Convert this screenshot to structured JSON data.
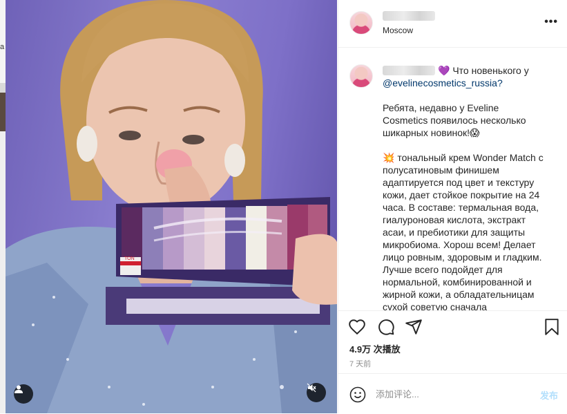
{
  "left_strip": {
    "text": "a"
  },
  "media": {
    "palette_label": "TON"
  },
  "header": {
    "location": "Moscow",
    "more_icon": "more-horizontal-icon"
  },
  "caption": {
    "first_line": "💜 Что новенького у",
    "mention": "@evelinecosmetics_russia?",
    "para1": "Ребята, недавно у Eveline Cosmetics появилось несколько шикарных новинок!😱",
    "para2": "💥 тональный крем Wonder Match с полусатиновым финишем адаптируется под цвет и текстуру кожи, дает стойкое покрытие на 24 часа. В составе: термальная вода, гиалуроновая кислота, экстракт асаи, и пребиотики для защиты микробиома. Хорош всем! Делает лицо ровным, здоровым и гладким. Лучше всего подойдет для нормальной, комбинированной и жирной кожи, а обладательницам сухой советую сначала"
  },
  "actions": {
    "like_icon": "heart-icon",
    "comment_icon": "comment-icon",
    "share_icon": "share-icon",
    "save_icon": "bookmark-icon"
  },
  "stats": {
    "views": "4.9万 次播放",
    "time_ago": "7 天前"
  },
  "comment": {
    "placeholder": "添加评论...",
    "post_label": "发布"
  }
}
